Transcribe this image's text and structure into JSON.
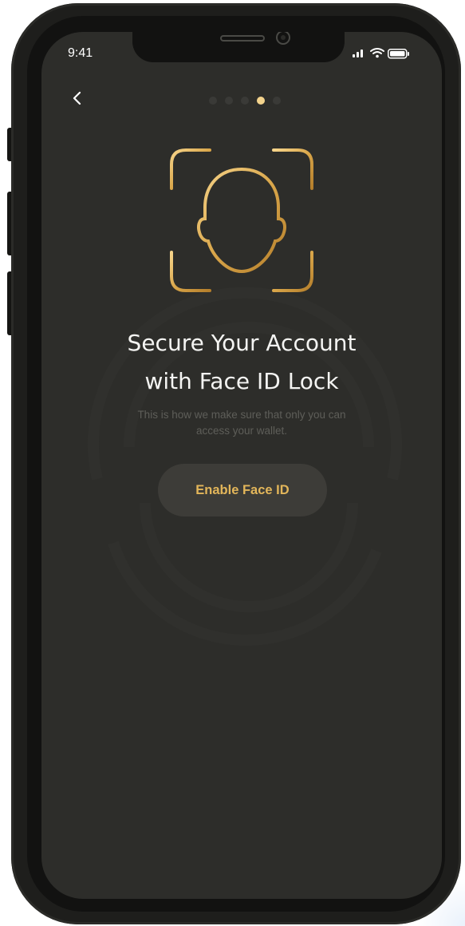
{
  "status_bar": {
    "time": "9:41",
    "icons": [
      "signal-icon",
      "wifi-icon",
      "battery-icon"
    ]
  },
  "navigation": {
    "back_icon": "chevron-left-icon",
    "pager": {
      "total_pages": 5,
      "active_index": 3
    }
  },
  "hero": {
    "icon": "face-id-icon"
  },
  "content": {
    "title_line1": "Secure Your Account",
    "title_line2": "with Face ID Lock",
    "subtitle_line1": "This is how we make sure that only you can",
    "subtitle_line2": "access your wallet."
  },
  "actions": {
    "enable_label": "Enable Face ID"
  },
  "colors": {
    "screen_bg": "#2d2d2a",
    "accent_gold": "#e3b65a",
    "active_dot": "#f3d38d",
    "button_bg": "#3d3c38"
  }
}
